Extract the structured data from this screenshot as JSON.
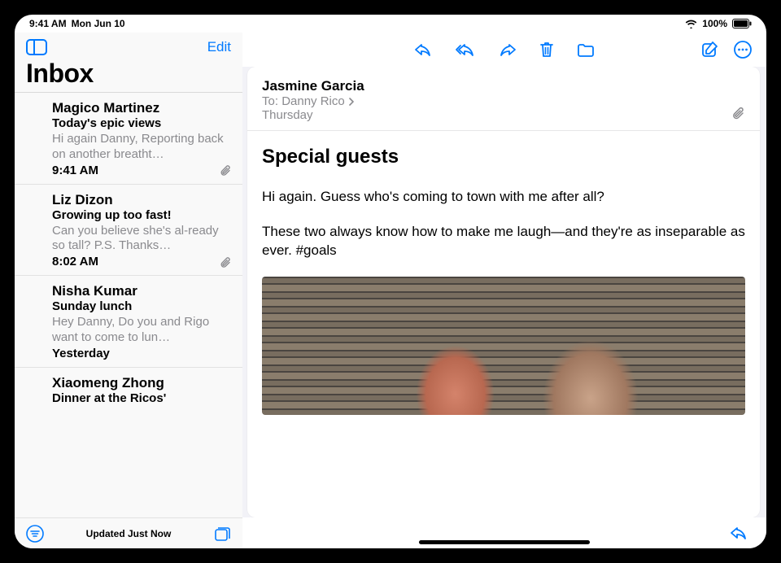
{
  "statusbar": {
    "time": "9:41 AM",
    "date": "Mon Jun 10",
    "battery_pct": "100%"
  },
  "sidebar": {
    "edit_label": "Edit",
    "title": "Inbox",
    "status": "Updated Just Now",
    "items": [
      {
        "sender": "Magico Martinez",
        "subject": "Today's epic views",
        "preview": "Hi again Danny, Reporting back on another breatht…",
        "time": "9:41 AM",
        "attachment": true
      },
      {
        "sender": "Liz Dizon",
        "subject": "Growing up too fast!",
        "preview": "Can you believe she's al-ready so tall? P.S. Thanks…",
        "time": "8:02 AM",
        "attachment": true
      },
      {
        "sender": "Nisha Kumar",
        "subject": "Sunday lunch",
        "preview": "Hey Danny, Do you and Rigo want to come to lun…",
        "time": "Yesterday",
        "attachment": false
      },
      {
        "sender": "Xiaomeng Zhong",
        "subject": "Dinner at the Ricos'",
        "preview": "",
        "time": "",
        "attachment": false
      }
    ]
  },
  "message": {
    "from": "Jasmine Garcia",
    "to_label": "To:",
    "to_name": "Danny Rico",
    "date": "Thursday",
    "subject": "Special guests",
    "body": [
      "Hi again. Guess who's coming to town with me after all?",
      "These two always know how to make me laugh—and they're as inseparable as ever. #goals"
    ]
  }
}
